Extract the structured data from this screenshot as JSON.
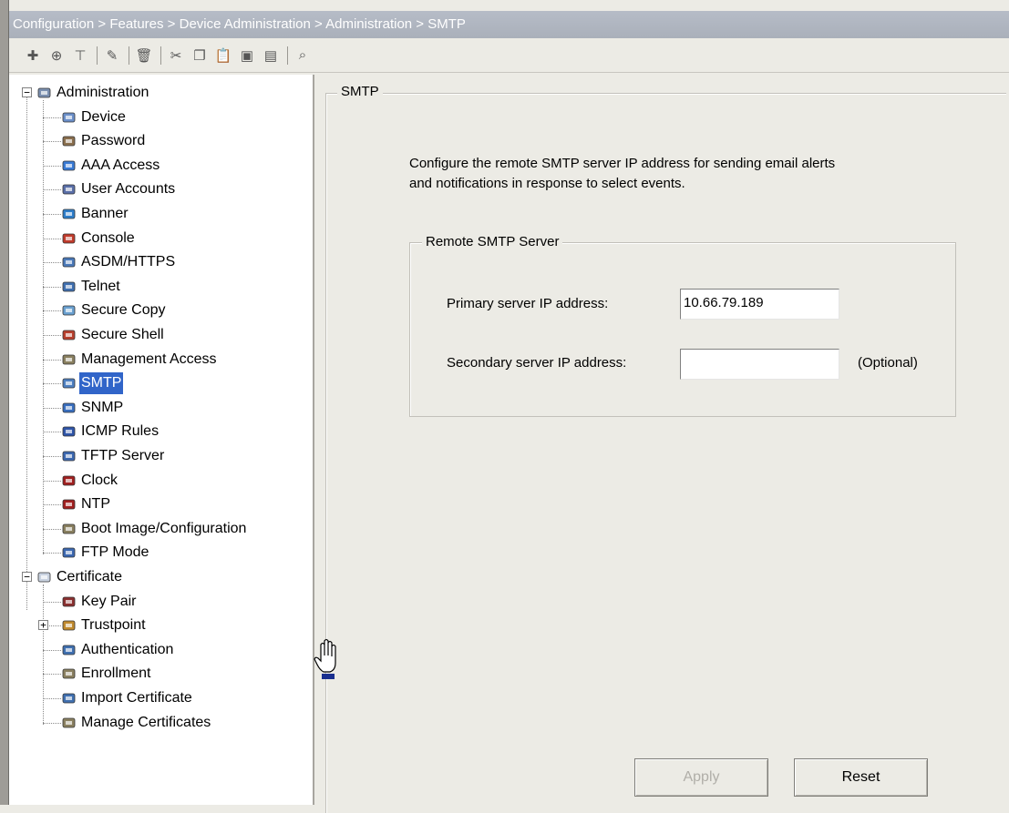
{
  "breadcrumb": "Configuration > Features > Device Administration > Administration > SMTP",
  "toolbar": {
    "buttons": [
      {
        "icon": "add-icon",
        "glyph": "✚"
      },
      {
        "icon": "insert-after-icon",
        "glyph": "⊕"
      },
      {
        "icon": "insert-before-icon",
        "glyph": "⊤"
      },
      {
        "icon": "edit-icon",
        "glyph": "✎"
      },
      {
        "icon": "delete-icon",
        "glyph": "🗑"
      },
      {
        "icon": "cut-icon",
        "glyph": "✂"
      },
      {
        "icon": "copy-icon",
        "glyph": "❐"
      },
      {
        "icon": "paste-icon",
        "glyph": "📋"
      },
      {
        "icon": "paste-after-icon",
        "glyph": "▣"
      },
      {
        "icon": "paste-before-icon",
        "glyph": "▤"
      },
      {
        "icon": "find-icon",
        "glyph": "⌕"
      }
    ]
  },
  "tree": {
    "administration": {
      "label": "Administration",
      "items": [
        {
          "label": "Device",
          "icon": "device-icon"
        },
        {
          "label": "Password",
          "icon": "password-icon"
        },
        {
          "label": "AAA Access",
          "icon": "aaa-access-icon"
        },
        {
          "label": "User Accounts",
          "icon": "user-accounts-icon"
        },
        {
          "label": "Banner",
          "icon": "banner-icon"
        },
        {
          "label": "Console",
          "icon": "console-icon"
        },
        {
          "label": "ASDM/HTTPS",
          "icon": "asdm-https-icon"
        },
        {
          "label": "Telnet",
          "icon": "telnet-icon"
        },
        {
          "label": "Secure Copy",
          "icon": "secure-copy-icon"
        },
        {
          "label": "Secure Shell",
          "icon": "secure-shell-icon"
        },
        {
          "label": "Management Access",
          "icon": "management-access-icon"
        },
        {
          "label": "SMTP",
          "icon": "smtp-icon",
          "selected": true
        },
        {
          "label": "SNMP",
          "icon": "snmp-icon"
        },
        {
          "label": "ICMP Rules",
          "icon": "icmp-rules-icon"
        },
        {
          "label": "TFTP Server",
          "icon": "tftp-server-icon"
        },
        {
          "label": "Clock",
          "icon": "clock-icon"
        },
        {
          "label": "NTP",
          "icon": "ntp-icon"
        },
        {
          "label": "Boot Image/Configuration",
          "icon": "boot-image-icon"
        },
        {
          "label": "FTP Mode",
          "icon": "ftp-mode-icon"
        }
      ]
    },
    "certificate": {
      "label": "Certificate",
      "items": [
        {
          "label": "Key Pair",
          "icon": "key-pair-icon"
        },
        {
          "label": "Trustpoint",
          "icon": "trustpoint-icon",
          "expandable": true
        },
        {
          "label": "Authentication",
          "icon": "authentication-icon"
        },
        {
          "label": "Enrollment",
          "icon": "enrollment-icon"
        },
        {
          "label": "Import Certificate",
          "icon": "import-certificate-icon"
        },
        {
          "label": "Manage Certificates",
          "icon": "manage-certificates-icon"
        }
      ]
    }
  },
  "panel": {
    "title": "SMTP",
    "description_line1": "Configure the remote SMTP server IP address for sending email alerts",
    "description_line2": "and notifications in response to select events.",
    "group_title": "Remote SMTP Server",
    "primary_label": "Primary server IP address:",
    "primary_value": "10.66.79.189",
    "secondary_label": "Secondary server IP address:",
    "secondary_value": "",
    "optional_note": "(Optional)",
    "apply_label": "Apply",
    "reset_label": "Reset"
  },
  "colors": {
    "selection": "#3165c9",
    "background": "#ecebe5",
    "titlebar": "#aab0ba"
  }
}
